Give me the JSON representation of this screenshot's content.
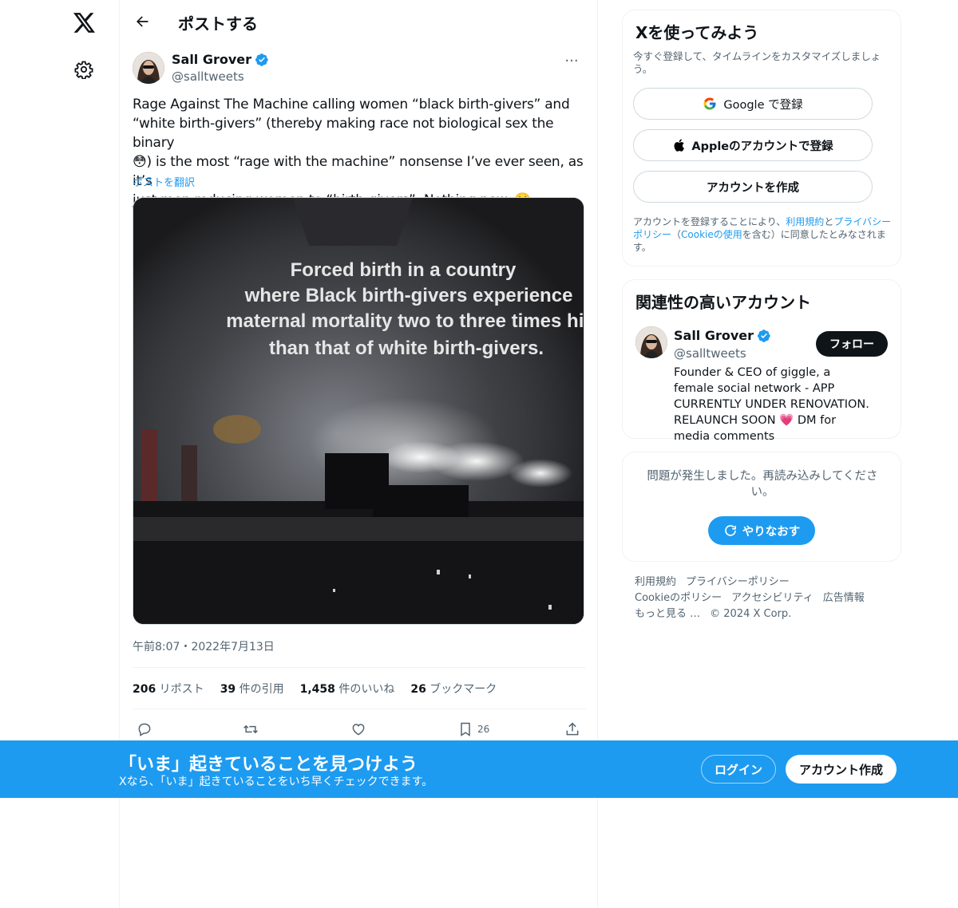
{
  "header": {
    "title": "ポストする"
  },
  "tweet": {
    "author_name": "Sall Grover",
    "author_handle": "@salltweets",
    "more_label": "···",
    "text_line1": "Rage Against The Machine calling women “black birth-givers” and",
    "text_line2": "“white birth-givers” (thereby making race not biological sex the binary",
    "text_line3_a": "😳",
    "text_line3_b": ") is the most “rage with the machine” nonsense I’ve ever seen, as it’s",
    "text_line4_a": "just men reducing women to “birth-givers”. Nothing new. ",
    "text_line4_b": "🙄",
    "translate_label": "ポストを翻訳",
    "media_text": [
      "Forced birth in a country",
      "where Black birth-givers experience",
      "maternal mortality two to three times high",
      "than that of white birth-givers."
    ],
    "timestamp": "午前8:07・2022年7月13日",
    "stats": [
      {
        "count": "206",
        "label": " リポスト"
      },
      {
        "count": "39",
        "label": " 件の引用"
      },
      {
        "count": "1,458",
        "label": " 件のいいね"
      },
      {
        "count": "26",
        "label": " ブックマーク"
      }
    ],
    "bookmark_count": "26"
  },
  "signup": {
    "title": "Xを使ってみよう",
    "subtitle": "今すぐ登録して、タイムラインをカスタマイズしましょう。",
    "google_label": "Google で登録",
    "apple_label": "Appleのアカウントで登録",
    "create_label": "アカウントを作成",
    "terms_a": "アカウントを登録することにより、",
    "terms_link1": "利用規約",
    "terms_b": "と",
    "terms_link2": "プライバシーポリシー",
    "terms_c": "（",
    "terms_link3": "Cookieの使用",
    "terms_d": "を含む）に同意したとみなされます。"
  },
  "relevant": {
    "title": "関連性の高いアカウント",
    "name": "Sall Grover",
    "handle": "@salltweets",
    "bio_a": "Founder & CEO of giggle, a female social network - APP CURRENTLY UNDER RENOVATION. RELAUNCH SOON ",
    "bio_heart": "💗",
    "bio_b": " DM for media comments",
    "follow_label": "フォロー"
  },
  "error": {
    "message": "問題が発生しました。再読み込みしてください。",
    "retry_label": "やりなおす"
  },
  "footer": {
    "links": [
      "利用規約",
      "プライバシーポリシー",
      "Cookieのポリシー",
      "アクセシビリティ",
      "広告情報",
      "もっと見る …"
    ],
    "copyright": "© 2024 X Corp."
  },
  "banner": {
    "title": "「いま」起きていることを見つけよう",
    "subtitle": "Xなら、「いま」起きていることをいち早くチェックできます。",
    "login_label": "ログイン",
    "create_label": "アカウント作成"
  },
  "colors": {
    "accent": "#1d9bf0",
    "text": "#0f1419",
    "muted": "#536471",
    "border": "#eff3f4"
  }
}
